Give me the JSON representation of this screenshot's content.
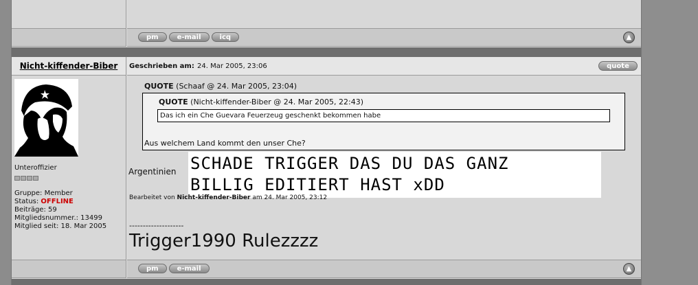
{
  "buttons": {
    "pm": "pm",
    "email": "e-mail",
    "icq": "icq",
    "quote": "quote"
  },
  "post": {
    "author": "Nicht-kiffender-Biber",
    "written_label": "Geschrieben am:",
    "written_date": "24. Mar 2005, 23:06",
    "rank": "Unteroffizier",
    "group": "Gruppe: Member",
    "status_label": "Status:",
    "status_value": "OFFLINE",
    "posts": "Beiträge: 59",
    "member_no": "Mitgliedsnummer.: 13499",
    "member_since": "Mitglied seit: 18. Mar 2005",
    "quote_outer": {
      "label": "QUOTE",
      "meta": "(Schaaf @ 24. Mar 2005, 23:04)",
      "text": "Aus welchem Land kommt den unser Che?"
    },
    "quote_inner": {
      "label": "QUOTE",
      "meta": "(Nicht-kiffender-Biber @ 24. Mar 2005, 22:43)",
      "text": "Das ich ein Che Guevara Feuerzeug geschenkt bekommen habe"
    },
    "answer": "Argentinien",
    "overlay_line1": "SCHADE TRIGGER DAS DU DAS GANZ",
    "overlay_line2": "BILLIG EDITIERT HAST xDD",
    "edited_prefix": "Bearbeitet von",
    "edited_user": "Nicht-kiffender-Biber",
    "edited_suffix": "am 24. Mar 2005, 23:12",
    "sig_divider": "--------------------",
    "signature": "Trigger1990 Rulezzzz"
  },
  "colors": {
    "offline": "#cc0000",
    "separator": "#6e6e6e"
  }
}
